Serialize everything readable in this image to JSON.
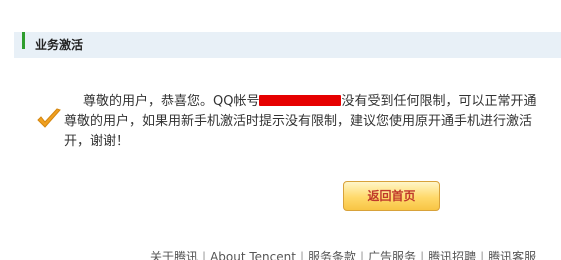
{
  "section": {
    "title": "业务激活"
  },
  "message": {
    "line1_before": "尊敬的用户，恭喜您。QQ帐号",
    "line1_after": "没有受到任何限制，可以正常开通",
    "line2": "尊敬的用户，如果用新手机激活时提示没有限制，建议您使用原开通手机进行激活",
    "line3": "开，谢谢！"
  },
  "button": {
    "label": "返回首页"
  },
  "footer": {
    "links": [
      "关于腾讯",
      "About Tencent",
      "服务条款",
      "广告服务",
      "腾讯招聘",
      "腾讯客服"
    ],
    "separator": "|"
  },
  "colors": {
    "accent": "#2e9d2e",
    "redaction": "#e60000",
    "button_text": "#c0392b"
  }
}
